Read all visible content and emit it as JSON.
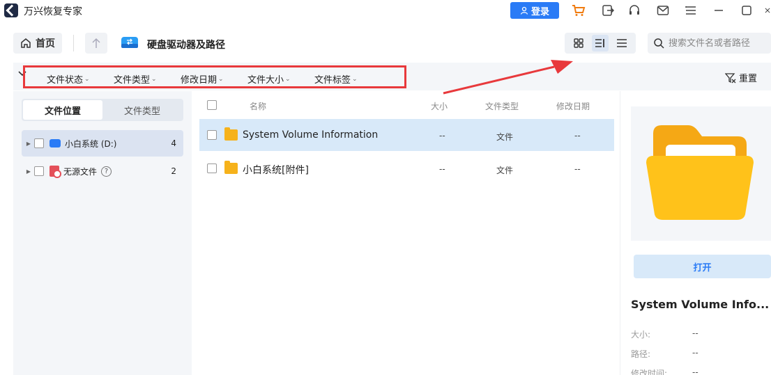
{
  "app": {
    "title": "万兴恢复专家",
    "login_label": "登录"
  },
  "toolbar": {
    "home_label": "首页",
    "page_title": "硬盘驱动器及路径",
    "search_placeholder": "搜索文件名或者路径"
  },
  "filters": {
    "items": [
      {
        "label": "文件状态"
      },
      {
        "label": "文件类型"
      },
      {
        "label": "修改日期"
      },
      {
        "label": "文件大小"
      },
      {
        "label": "文件标签"
      }
    ],
    "reset_label": "重置"
  },
  "sidebar": {
    "tabs": [
      {
        "label": "文件位置"
      },
      {
        "label": "文件类型"
      }
    ],
    "items": [
      {
        "label": "小白系统 (D:)",
        "count": "4"
      },
      {
        "label": "无源文件",
        "count": "2"
      }
    ]
  },
  "list": {
    "headers": {
      "name": "名称",
      "size": "大小",
      "type": "文件类型",
      "date": "修改日期"
    },
    "rows": [
      {
        "name": "System Volume Information",
        "size": "--",
        "type": "文件",
        "date": "--"
      },
      {
        "name": "小白系统[附件]",
        "size": "--",
        "type": "文件",
        "date": "--"
      }
    ]
  },
  "preview": {
    "open_label": "打开",
    "name": "System Volume Info...",
    "meta": [
      {
        "key": "大小:",
        "value": "--"
      },
      {
        "key": "路径:",
        "value": "--"
      },
      {
        "key": "修改时间:",
        "value": "--"
      }
    ]
  },
  "colors": {
    "accent": "#2a7bf6",
    "highlight": "#e8393c",
    "folder": "#f6b21b"
  }
}
